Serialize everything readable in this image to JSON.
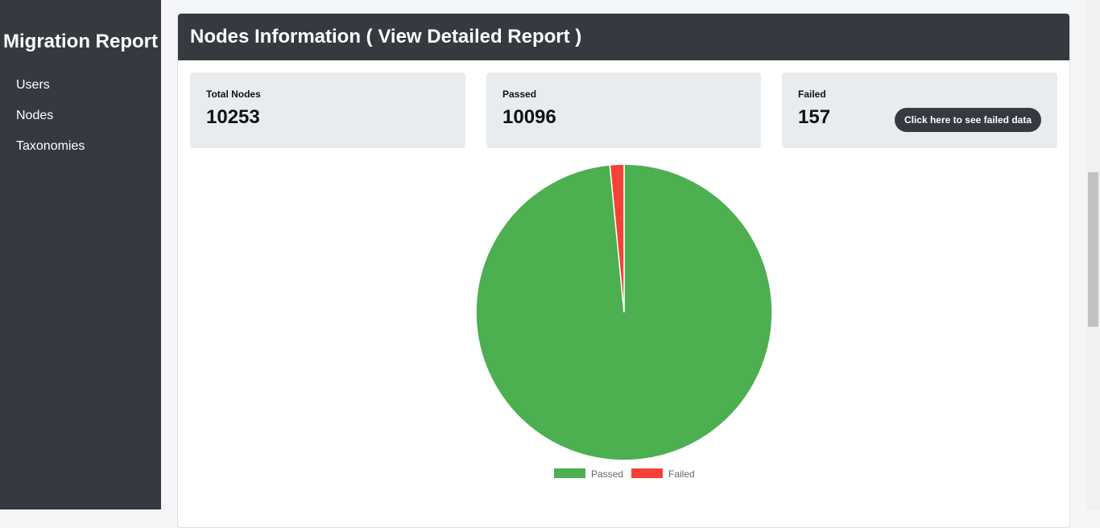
{
  "sidebar": {
    "title": "Migration Report",
    "items": [
      {
        "label": "Users"
      },
      {
        "label": "Nodes"
      },
      {
        "label": "Taxonomies"
      }
    ]
  },
  "header": {
    "title": "Nodes Information ( View Detailed Report )"
  },
  "stats": {
    "total": {
      "label": "Total Nodes",
      "value": "10253"
    },
    "passed": {
      "label": "Passed",
      "value": "10096"
    },
    "failed": {
      "label": "Failed",
      "value": "157",
      "button_label": "Click here to see failed data"
    }
  },
  "colors": {
    "sidebar_bg": "#343a40",
    "passed": "#4caf50",
    "failed": "#f44336"
  },
  "chart_data": {
    "type": "pie",
    "categories": [
      "Passed",
      "Failed"
    ],
    "values": [
      10096,
      157
    ],
    "colors": [
      "#4caf50",
      "#f44336"
    ],
    "legend": "bottom"
  }
}
